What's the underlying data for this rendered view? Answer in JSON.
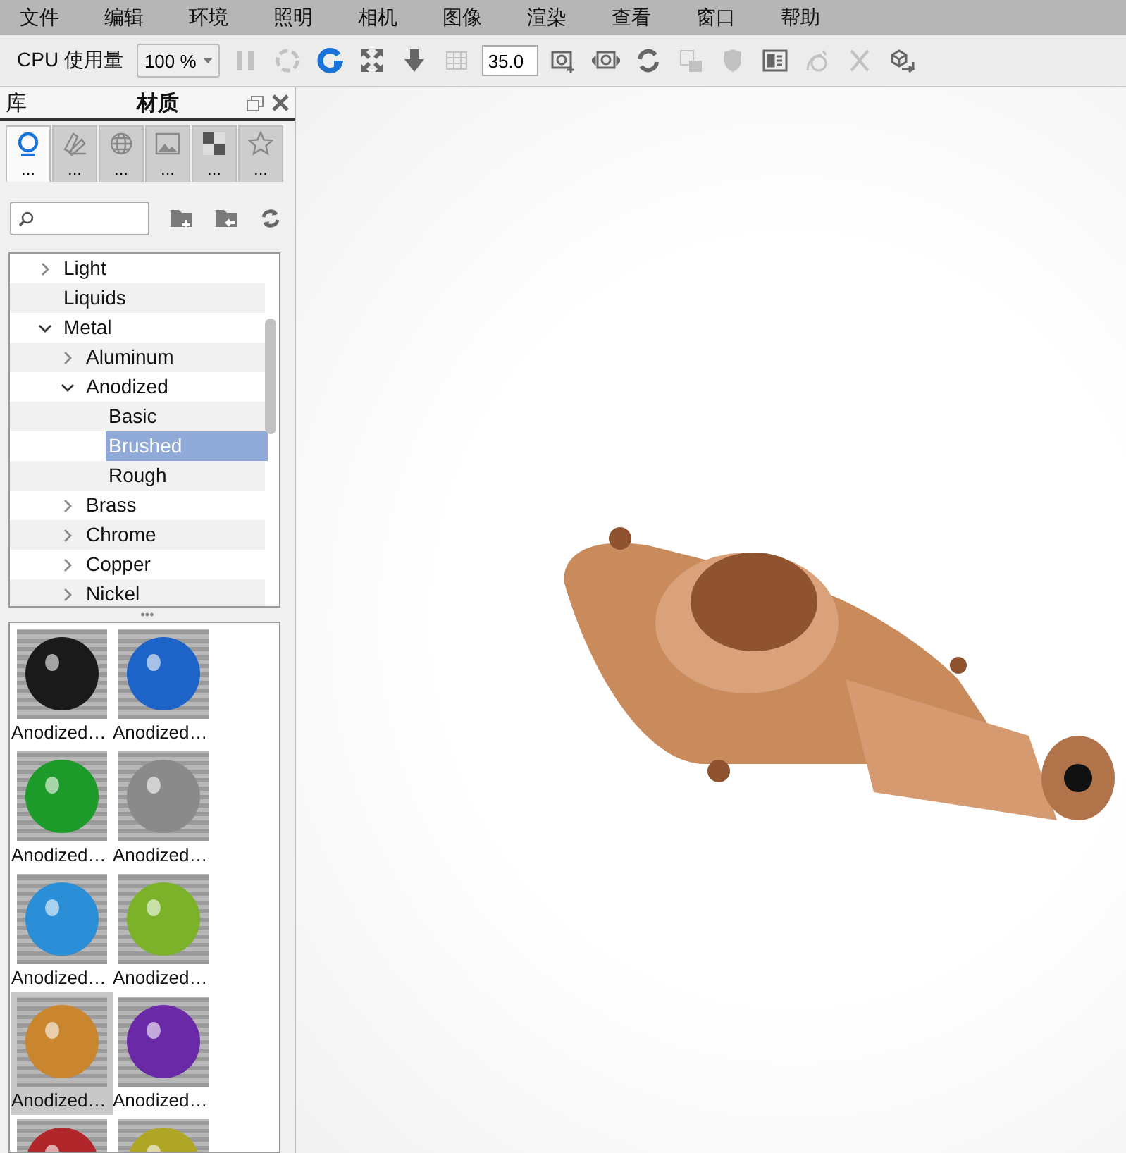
{
  "menu": [
    "文件",
    "编辑",
    "环境",
    "照明",
    "相机",
    "图像",
    "渲染",
    "查看",
    "窗口",
    "帮助"
  ],
  "toolbar": {
    "cpu_label": "CPU 使用量",
    "cpu_dropdown": "100 %",
    "field_value": "35.0",
    "tools": [
      {
        "kind": "pause",
        "disabled": true
      },
      {
        "kind": "spin",
        "disabled": true
      },
      {
        "kind": "refresh",
        "disabled": false
      },
      {
        "kind": "expand",
        "disabled": false
      },
      {
        "kind": "down",
        "disabled": false
      },
      {
        "kind": "grid",
        "disabled": true
      },
      {
        "kind": "field"
      },
      {
        "kind": "camera-add",
        "disabled": false
      },
      {
        "kind": "camera-nav",
        "disabled": false
      },
      {
        "kind": "cycle",
        "disabled": false
      },
      {
        "kind": "lock",
        "disabled": true
      },
      {
        "kind": "shield",
        "disabled": true
      },
      {
        "kind": "layout",
        "disabled": false
      },
      {
        "kind": "curve",
        "disabled": true
      },
      {
        "kind": "nodes",
        "disabled": true
      },
      {
        "kind": "export",
        "disabled": false
      }
    ]
  },
  "panel": {
    "left_title": "库",
    "title": "材质",
    "tabs": [
      {
        "kind": "materials",
        "label": "...",
        "selected": true
      },
      {
        "kind": "colors",
        "label": "...",
        "selected": false
      },
      {
        "kind": "environments",
        "label": "...",
        "selected": false
      },
      {
        "kind": "backplates",
        "label": "...",
        "selected": false
      },
      {
        "kind": "textures",
        "label": "...",
        "selected": false
      },
      {
        "kind": "favorites",
        "label": "...",
        "selected": false
      }
    ],
    "tree": [
      {
        "label": "Light",
        "expanded": false,
        "selected": false
      },
      {
        "label": "Liquids",
        "selected": false
      },
      {
        "label": "Metal",
        "expanded": true,
        "selected": false,
        "children": [
          {
            "label": "Aluminum",
            "expanded": false,
            "selected": false
          },
          {
            "label": "Anodized",
            "expanded": true,
            "selected": false,
            "children": [
              {
                "label": "Basic",
                "selected": false
              },
              {
                "label": "Brushed",
                "selected": true
              },
              {
                "label": "Rough",
                "selected": false
              }
            ]
          },
          {
            "label": "Brass",
            "expanded": false,
            "selected": false
          },
          {
            "label": "Chrome",
            "expanded": false,
            "selected": false
          },
          {
            "label": "Copper",
            "expanded": false,
            "selected": false
          },
          {
            "label": "Nickel",
            "expanded": false,
            "selected": false
          }
        ]
      }
    ],
    "splitter": "•••",
    "materials": [
      {
        "label": "Anodized…",
        "color": "#1a1a1a",
        "selected": false
      },
      {
        "label": "Anodized…",
        "color": "#1e63c8",
        "selected": false
      },
      {
        "label": "Anodized…",
        "color": "#1d9a2a",
        "selected": false
      },
      {
        "label": "Anodized…",
        "color": "#8a8a8a",
        "selected": false
      },
      {
        "label": "Anodized…",
        "color": "#2a8fd6",
        "selected": false
      },
      {
        "label": "Anodized…",
        "color": "#7bb22a",
        "selected": false
      },
      {
        "label": "Anodized…",
        "color": "#c9862e",
        "selected": true
      },
      {
        "label": "Anodized…",
        "color": "#6a2aa8",
        "selected": false
      },
      {
        "color": "#b0262a",
        "selected": false
      },
      {
        "color": "#b0a626",
        "selected": false
      }
    ]
  }
}
